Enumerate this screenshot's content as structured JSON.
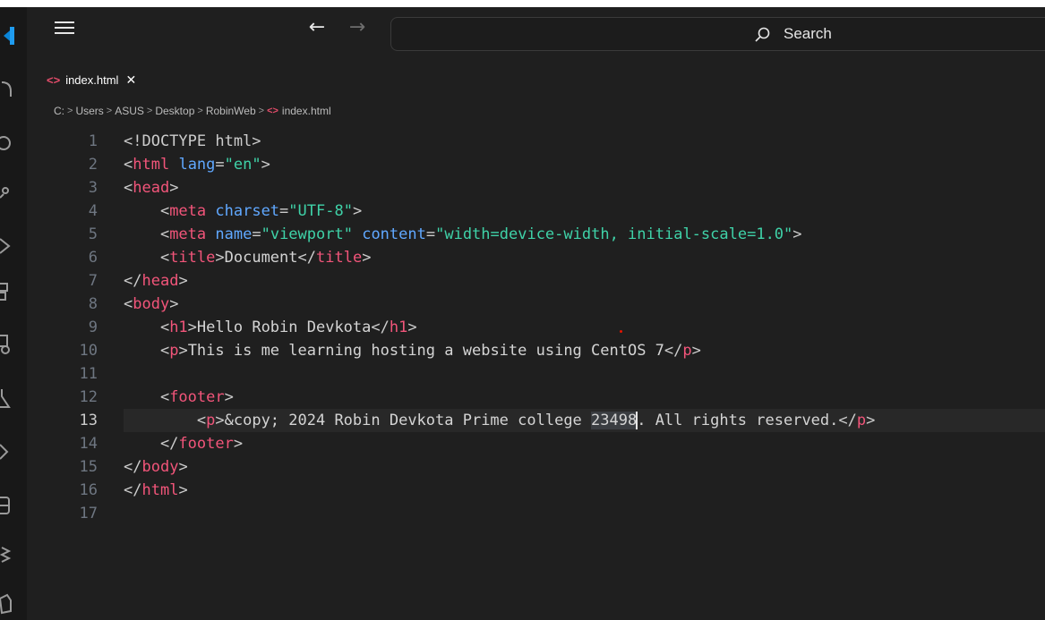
{
  "titlebar": {
    "nav_back": "←",
    "nav_forward": "→",
    "search_label": "Search"
  },
  "tab": {
    "icon": "<>",
    "label": "index.html",
    "close": "✕"
  },
  "breadcrumb": {
    "items": [
      "C:",
      "Users",
      "ASUS",
      "Desktop",
      "RobinWeb",
      "index.html"
    ],
    "separator": ">"
  },
  "editor": {
    "active_line": 13,
    "lines": [
      {
        "n": "1",
        "tokens": [
          {
            "t": "<!DOCTYPE html>",
            "c": "br"
          }
        ]
      },
      {
        "n": "2",
        "tokens": [
          {
            "t": "<",
            "c": "br"
          },
          {
            "t": "html",
            "c": "tag"
          },
          {
            "t": " ",
            "c": "txt"
          },
          {
            "t": "lang",
            "c": "attr"
          },
          {
            "t": "=",
            "c": "br"
          },
          {
            "t": "\"en\"",
            "c": "val"
          },
          {
            "t": ">",
            "c": "br"
          }
        ]
      },
      {
        "n": "3",
        "tokens": [
          {
            "t": "<",
            "c": "br"
          },
          {
            "t": "head",
            "c": "tag"
          },
          {
            "t": ">",
            "c": "br"
          }
        ]
      },
      {
        "n": "4",
        "tokens": [
          {
            "t": "    <",
            "c": "br"
          },
          {
            "t": "meta",
            "c": "tag"
          },
          {
            "t": " ",
            "c": "txt"
          },
          {
            "t": "charset",
            "c": "attr"
          },
          {
            "t": "=",
            "c": "br"
          },
          {
            "t": "\"UTF-8\"",
            "c": "val"
          },
          {
            "t": ">",
            "c": "br"
          }
        ]
      },
      {
        "n": "5",
        "tokens": [
          {
            "t": "    <",
            "c": "br"
          },
          {
            "t": "meta",
            "c": "tag"
          },
          {
            "t": " ",
            "c": "txt"
          },
          {
            "t": "name",
            "c": "attr"
          },
          {
            "t": "=",
            "c": "br"
          },
          {
            "t": "\"viewport\"",
            "c": "val"
          },
          {
            "t": " ",
            "c": "txt"
          },
          {
            "t": "content",
            "c": "attr"
          },
          {
            "t": "=",
            "c": "br"
          },
          {
            "t": "\"width=device-width, initial-scale=1.0\"",
            "c": "val"
          },
          {
            "t": ">",
            "c": "br"
          }
        ]
      },
      {
        "n": "6",
        "tokens": [
          {
            "t": "    <",
            "c": "br"
          },
          {
            "t": "title",
            "c": "tag"
          },
          {
            "t": ">",
            "c": "br"
          },
          {
            "t": "Document",
            "c": "txt"
          },
          {
            "t": "</",
            "c": "br"
          },
          {
            "t": "title",
            "c": "tag"
          },
          {
            "t": ">",
            "c": "br"
          }
        ]
      },
      {
        "n": "7",
        "tokens": [
          {
            "t": "</",
            "c": "br"
          },
          {
            "t": "head",
            "c": "tag"
          },
          {
            "t": ">",
            "c": "br"
          }
        ]
      },
      {
        "n": "8",
        "tokens": [
          {
            "t": "<",
            "c": "br"
          },
          {
            "t": "body",
            "c": "tag"
          },
          {
            "t": ">",
            "c": "br"
          }
        ]
      },
      {
        "n": "9",
        "tokens": [
          {
            "t": "    <",
            "c": "br"
          },
          {
            "t": "h1",
            "c": "tag"
          },
          {
            "t": ">",
            "c": "br"
          },
          {
            "t": "Hello Robin Devkota",
            "c": "txt"
          },
          {
            "t": "</",
            "c": "br"
          },
          {
            "t": "h1",
            "c": "tag"
          },
          {
            "t": ">",
            "c": "br"
          }
        ]
      },
      {
        "n": "10",
        "tokens": [
          {
            "t": "    <",
            "c": "br"
          },
          {
            "t": "p",
            "c": "tag"
          },
          {
            "t": ">",
            "c": "br"
          },
          {
            "t": "This is me learning hosting a website using CentOS 7",
            "c": "txt"
          },
          {
            "t": "</",
            "c": "br"
          },
          {
            "t": "p",
            "c": "tag"
          },
          {
            "t": ">",
            "c": "br"
          }
        ]
      },
      {
        "n": "11",
        "tokens": []
      },
      {
        "n": "12",
        "tokens": [
          {
            "t": "    <",
            "c": "br"
          },
          {
            "t": "footer",
            "c": "tag"
          },
          {
            "t": ">",
            "c": "br"
          }
        ]
      },
      {
        "n": "13",
        "tokens": [
          {
            "t": "        <",
            "c": "br"
          },
          {
            "t": "p",
            "c": "tag"
          },
          {
            "t": ">",
            "c": "br"
          },
          {
            "t": "&copy; 2024 Robin Devkota Prime college ",
            "c": "txt"
          },
          {
            "t": "23498",
            "c": "txt",
            "hl": true
          },
          {
            "t": "",
            "c": "cursor"
          },
          {
            "t": ". All rights reserved.",
            "c": "txt"
          },
          {
            "t": "</",
            "c": "br"
          },
          {
            "t": "p",
            "c": "tag"
          },
          {
            "t": ">",
            "c": "br"
          }
        ]
      },
      {
        "n": "14",
        "tokens": [
          {
            "t": "    </",
            "c": "br"
          },
          {
            "t": "footer",
            "c": "tag"
          },
          {
            "t": ">",
            "c": "br"
          }
        ]
      },
      {
        "n": "15",
        "tokens": [
          {
            "t": "</",
            "c": "br"
          },
          {
            "t": "body",
            "c": "tag"
          },
          {
            "t": ">",
            "c": "br"
          }
        ]
      },
      {
        "n": "16",
        "tokens": [
          {
            "t": "</",
            "c": "br"
          },
          {
            "t": "html",
            "c": "tag"
          },
          {
            "t": ">",
            "c": "br"
          }
        ]
      },
      {
        "n": "17",
        "tokens": []
      }
    ]
  },
  "colors": {
    "tag": "#f2557a",
    "attribute": "#60a8ff",
    "string": "#3fd2a8",
    "background": "#1f1f1f",
    "html_file_icon": "#e34c6a"
  }
}
